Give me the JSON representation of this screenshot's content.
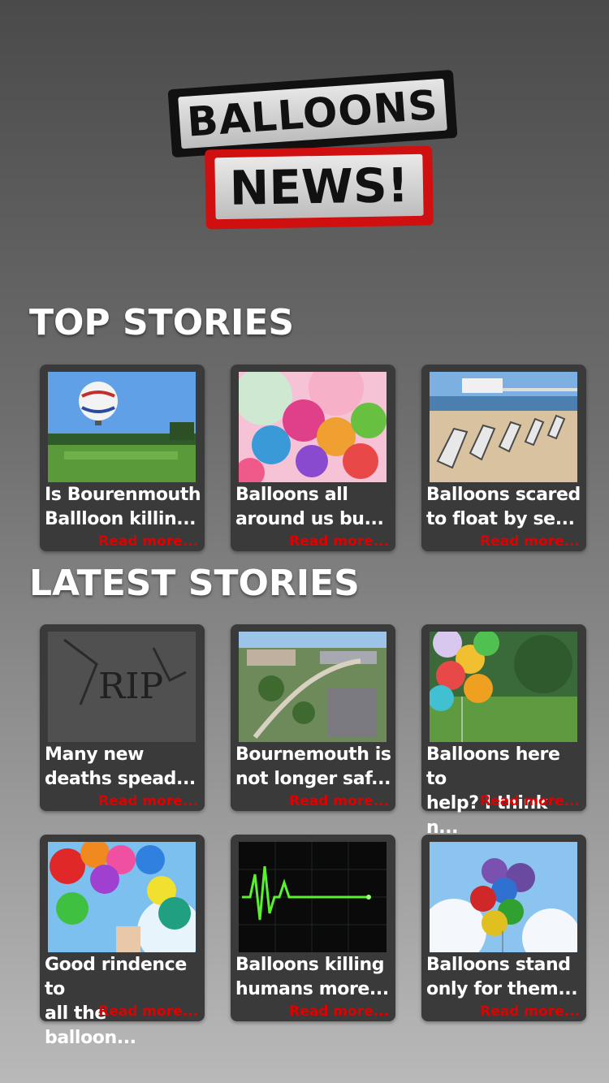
{
  "logo": {
    "line1": "BALLOONS",
    "line2": "NEWS!"
  },
  "sections": {
    "top": "TOP STORIES",
    "latest": "LATEST STORIES"
  },
  "read_more": "Read more...",
  "top_stories": [
    {
      "title": "Is Bourenmouth\nBallloon killin...",
      "image": "hot-air-balloon-park"
    },
    {
      "title": "Balloons all\naround us bu...",
      "image": "colorful-balloons"
    },
    {
      "title": "Balloons scared\nto float by se...",
      "image": "beach-pier-deckchairs"
    }
  ],
  "latest_stories": [
    {
      "title": "Many new\ndeaths spead...",
      "image": "rip-gravestone"
    },
    {
      "title": "Bournemouth is\nnot longer saf...",
      "image": "town-aerial"
    },
    {
      "title": "Balloons here to\nhelp? I think n...",
      "image": "balloons-on-grass"
    },
    {
      "title": "Good rindence to\nall the balloon...",
      "image": "hand-holding-balloons"
    },
    {
      "title": "Balloons killing\nhumans more...",
      "image": "heart-monitor-flatline"
    },
    {
      "title": "Balloons stand\nonly for them...",
      "image": "balloons-sky"
    }
  ]
}
